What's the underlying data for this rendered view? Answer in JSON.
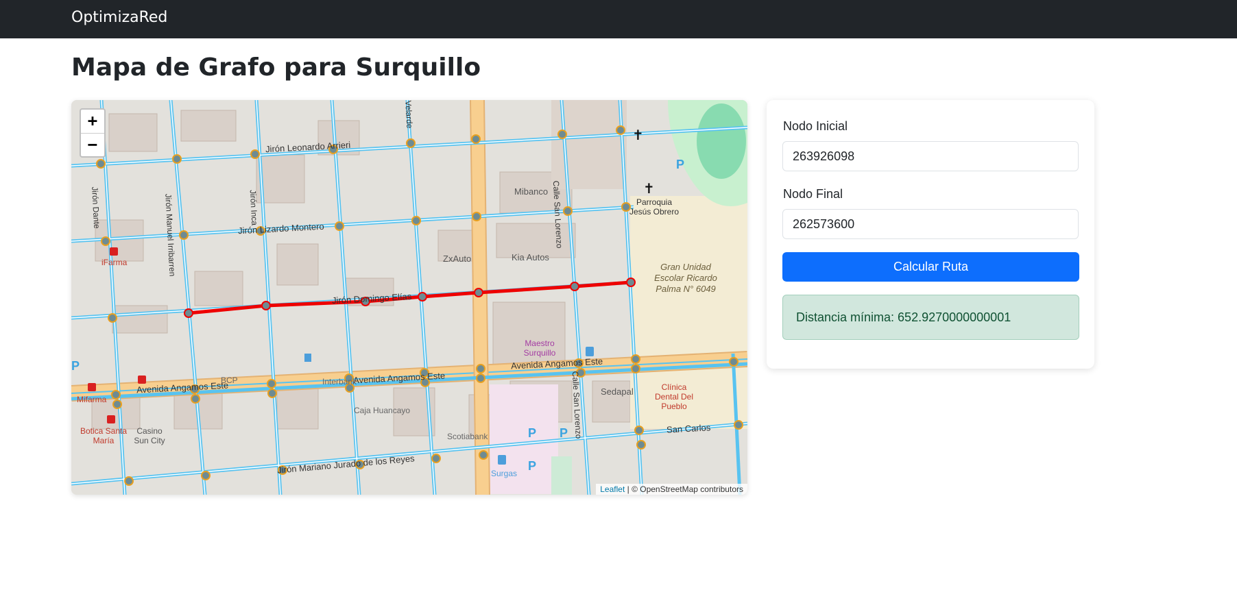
{
  "navbar": {
    "brand": "OptimizaRed"
  },
  "page": {
    "title": "Mapa de Grafo para Surquillo"
  },
  "map": {
    "zoom_in": "+",
    "zoom_out": "−",
    "attribution_link": "Leaflet",
    "attribution_text": " | © OpenStreetMap contributors",
    "labels": {
      "jiron_leonardo_arrieri": "Jirón Leonardo Arrieri",
      "jiron_lizardo_montero": "Jirón Lizardo Montero",
      "jiron_domingo_elias": "Jirón Domingo Elías",
      "avenida_angamos_este": "Avenida Angamos Este",
      "jiron_mariano_jurado": "Jirón Mariano Jurado de los Reyes",
      "jiron_dante": "Jirón Dante",
      "jiron_irribarren": "Jirón Manuel Irribarren",
      "jiron_inca": "Jirón Inca",
      "calle_san_lorenzo": "Calle San Lorenzo",
      "san_carlos": "San Carlos",
      "velarde": "Velarde",
      "mibanco": "Mibanco",
      "kia_autos": "Kia Autos",
      "zxauto": "ZxAuto",
      "ifarma": "iFarma",
      "mifarma": "Mifarma",
      "caja_huancayo": "Caja Huancayo",
      "scotiabank": "Scotiabank",
      "sedapal": "Sedapal",
      "maestro": "Maestro Surquillo",
      "gran_unidad": "Gran Unidad Escolar Ricardo Palma N° 6049",
      "parroquia": "Parroquia Jesús Obrero",
      "clinica": "Clínica Dental Del Pueblo",
      "botica": "Botica Santa María",
      "casino": "Casino Sun City",
      "interbank": "Interbank",
      "bcp": "BCP",
      "surgas": "Surgas"
    },
    "colors": {
      "route": "#ee0000",
      "node": "#6e8b92",
      "street": "#58c3f0",
      "avenue": "#f8cf8f"
    }
  },
  "form": {
    "start_label": "Nodo Inicial",
    "start_value": "263926098",
    "end_label": "Nodo Final",
    "end_value": "262573600",
    "button_label": "Calcular Ruta",
    "result_text": "Distancia mínima: 652.9270000000001"
  }
}
